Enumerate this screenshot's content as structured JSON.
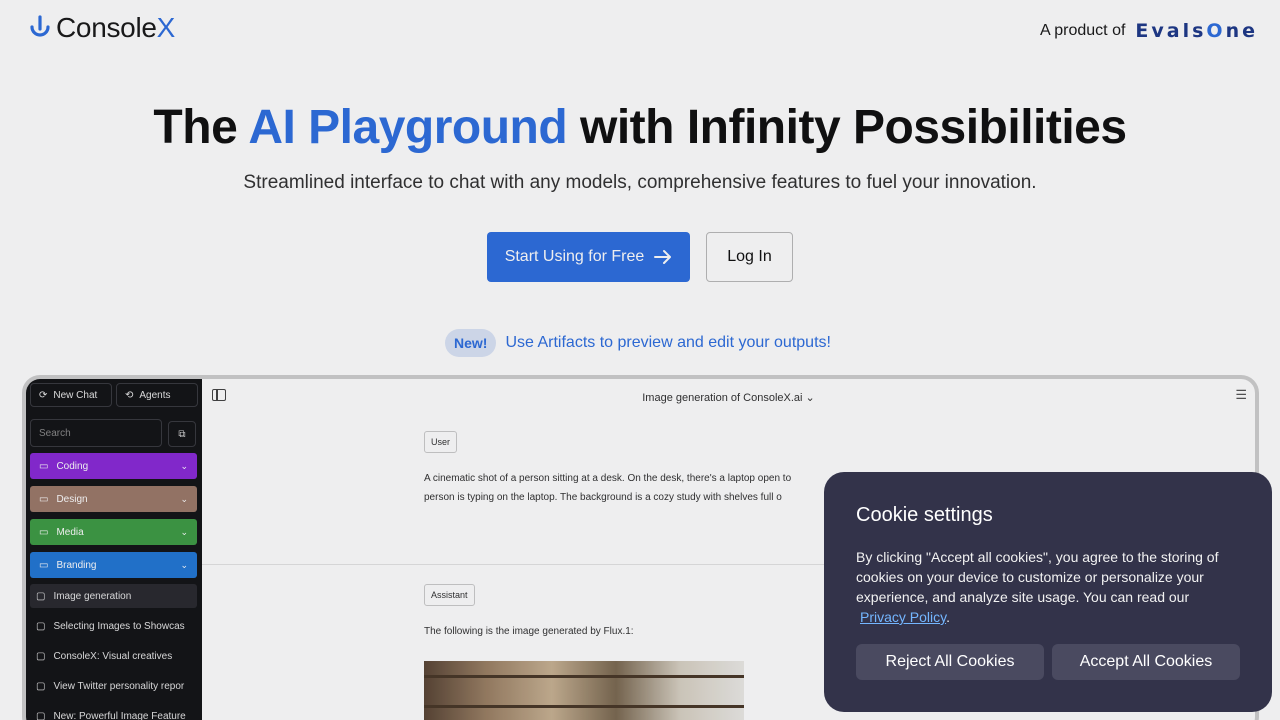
{
  "header": {
    "logo_text": "Console",
    "logo_accent": "X",
    "product_label": "A product of",
    "product_brand_pre": "Evals",
    "product_brand_o": "O",
    "product_brand_post": "ne"
  },
  "hero": {
    "title_pre": "The ",
    "title_accent": "AI Playground",
    "title_post": " with Infinity Possibilities",
    "subtitle": "Streamlined interface to chat with any models, comprehensive features to fuel your innovation.",
    "primary_button": "Start Using for Free",
    "secondary_button": "Log In",
    "new_badge": "New!",
    "new_link": "Use Artifacts to preview and edit your outputs!"
  },
  "preview": {
    "new_chat": "New Chat",
    "agents": "Agents",
    "search_placeholder": "Search",
    "folders": [
      {
        "label": "Coding",
        "color": "#8a2bd8"
      },
      {
        "label": "Design",
        "color": "#9c7a6a"
      },
      {
        "label": "Media",
        "color": "#3f9d45"
      },
      {
        "label": "Branding",
        "color": "#2378d6"
      }
    ],
    "chats": [
      "Image generation",
      "Selecting Images to Showcas",
      "ConsoleX: Visual creatives",
      "View Twitter personality repor",
      "New: Powerful Image Feature"
    ],
    "conversation_title": "Image generation of ConsoleX.ai",
    "user_role": "User",
    "user_message_line1": "A cinematic shot of a person sitting at a desk. On the desk, there's a laptop open to",
    "user_message_line2": "person is typing on the laptop. The background is a cozy study with shelves full o",
    "assistant_role": "Assistant",
    "assistant_message": "The following is the image generated by Flux.1:"
  },
  "cookie": {
    "title": "Cookie settings",
    "body": "By clicking \"Accept all cookies\", you agree to the storing of cookies on your device to customize or personalize your experience, and analyze site usage. You can read our",
    "policy_link": "Privacy Policy",
    "period": ".",
    "reject": "Reject All Cookies",
    "accept": "Accept All Cookies"
  }
}
